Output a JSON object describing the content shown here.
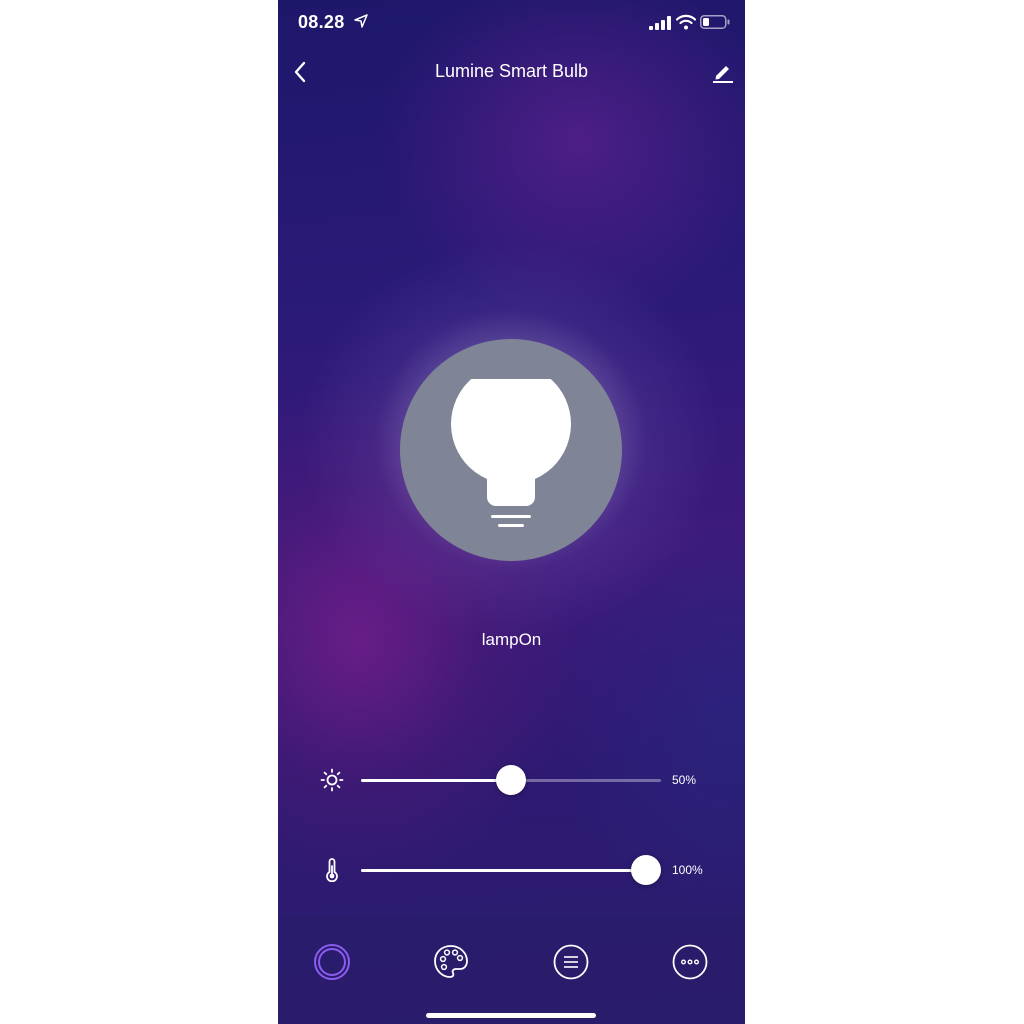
{
  "status_bar": {
    "time": "08.28",
    "location_icon": "location-arrow-icon",
    "signal_icon": "cellular-signal-icon",
    "wifi_icon": "wifi-icon",
    "battery_icon": "battery-icon"
  },
  "header": {
    "title": "Lumine Smart Bulb",
    "back_icon": "chevron-left-icon",
    "edit_icon": "pencil-icon"
  },
  "bulb": {
    "icon": "light-bulb-icon",
    "state_label": "lampOn"
  },
  "sliders": {
    "brightness": {
      "icon": "sun-icon",
      "value": 50,
      "value_label": "50%"
    },
    "temperature": {
      "icon": "thermometer-icon",
      "value": 100,
      "value_label": "100%"
    }
  },
  "tabbar": {
    "tabs": [
      {
        "name": "power",
        "icon": "ring-icon",
        "active": true
      },
      {
        "name": "color",
        "icon": "palette-icon",
        "active": false
      },
      {
        "name": "scenes",
        "icon": "list-icon",
        "active": false
      },
      {
        "name": "more",
        "icon": "more-dots-icon",
        "active": false
      }
    ]
  },
  "colors": {
    "accent": "#8a5cf0",
    "bulb_circle": "#7f8496",
    "text": "#ffffff"
  }
}
